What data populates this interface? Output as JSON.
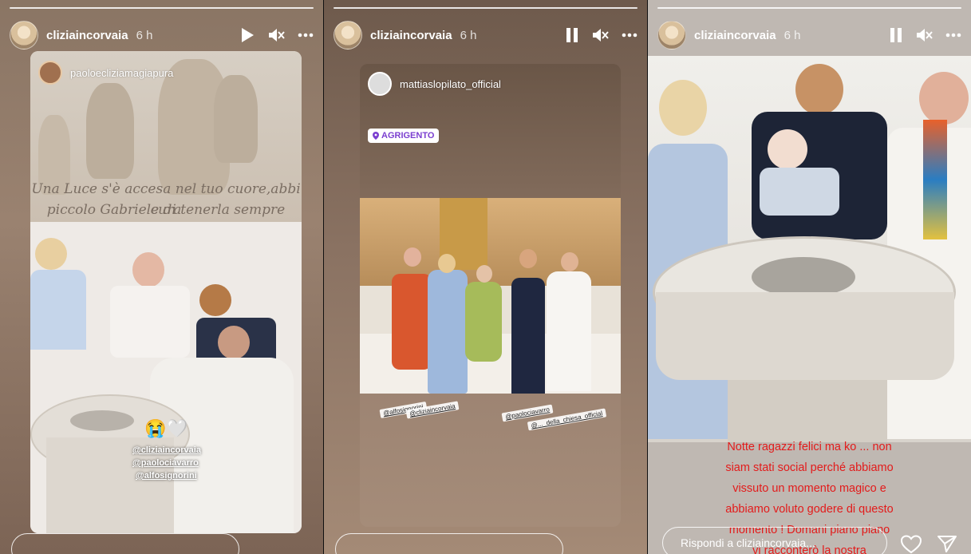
{
  "stories": [
    {
      "username": "cliziaincorvaia",
      "time": "6 h",
      "repost_username": "paoloecliziamagiapura",
      "caption_lines": [
        "Una Luce s'è accesa nel tuo cuore,abbi cura",
        "piccolo Gabriele di tenerla sempre viva....."
      ],
      "mentions": [
        "@cliziaincorvaia",
        "@paolociavarro",
        "@alfosignorini"
      ],
      "emoji": "😭🤍",
      "playback": "play-icon",
      "sound": "muted-icon"
    },
    {
      "username": "cliziaincorvaia",
      "time": "6 h",
      "repost_username": "mattiaslopilato_official",
      "location": "AGRIGENTO",
      "photo_tags": [
        "@alfosignorini",
        "@cliziaincorvaia",
        "@paolociavarro",
        "@..._della_chiesa_official"
      ],
      "playback": "pause-icon",
      "sound": "muted-icon"
    },
    {
      "username": "cliziaincorvaia",
      "time": "6 h",
      "caption_lines": [
        "Notte ragazzi felici ma ko ... non",
        "siam stati social perché abbiamo",
        "vissuto un momento magico  e",
        "abbiamo voluto godere di questo",
        "momento ! Domani piano piano",
        "vi racconterò la nostra"
      ],
      "reply_placeholder": "Rispondi a cliziaincorvaia...",
      "playback": "pause-icon",
      "sound": "muted-icon"
    }
  ]
}
